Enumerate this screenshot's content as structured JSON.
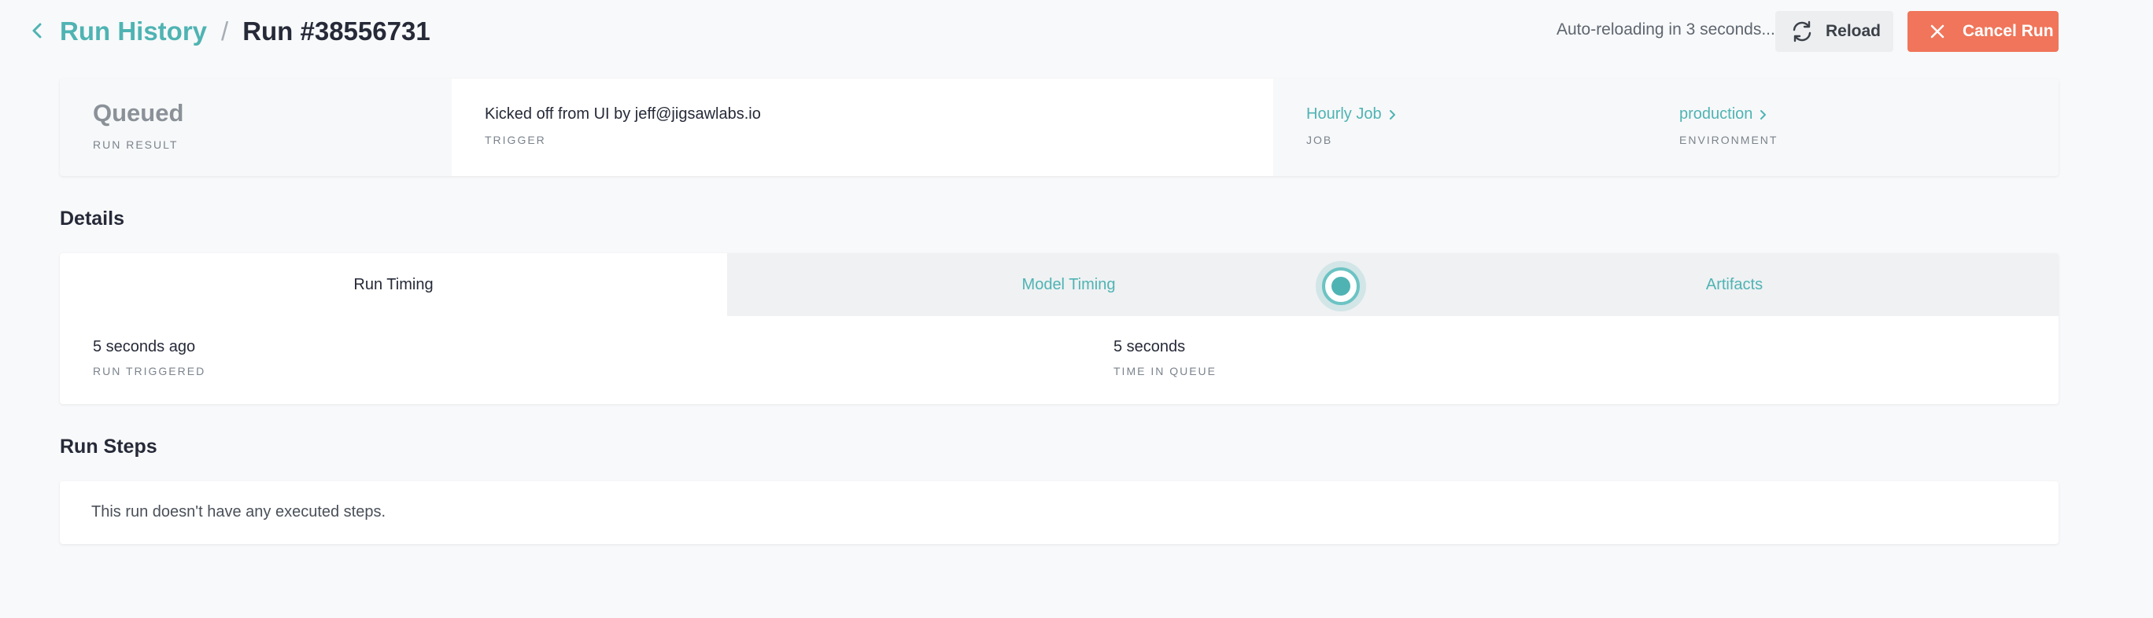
{
  "header": {
    "breadcrumb_parent": "Run History",
    "breadcrumb_separator": "/",
    "run_title": "Run #38556731",
    "auto_reload_text": "Auto-reloading in 3 seconds...",
    "reload_label": "Reload",
    "cancel_label": "Cancel Run"
  },
  "summary": {
    "result_value": "Queued",
    "result_label": "RUN RESULT",
    "trigger_value": "Kicked off from UI by jeff@jigsawlabs.io",
    "trigger_label": "TRIGGER",
    "job_value": "Hourly Job",
    "job_label": "JOB",
    "environment_value": "production",
    "environment_label": "ENVIRONMENT"
  },
  "details": {
    "title": "Details",
    "tabs": [
      {
        "label": "Run Timing",
        "active": true
      },
      {
        "label": "Model Timing",
        "active": false
      },
      {
        "label": "Artifacts",
        "active": false
      }
    ],
    "run_triggered_value": "5 seconds ago",
    "run_triggered_label": "RUN TRIGGERED",
    "time_in_queue_value": "5 seconds",
    "time_in_queue_label": "TIME IN QUEUE"
  },
  "run_steps": {
    "title": "Run Steps",
    "empty_message": "This run doesn't have any executed steps."
  },
  "icons": {
    "back": "chevron-left-icon",
    "reload": "refresh-icon",
    "cancel": "close-icon",
    "link_chevron": "chevron-right-icon"
  },
  "colors": {
    "accent": "#4fb3b3",
    "cancel_button": "#f0755a",
    "background": "#f8f9fa"
  }
}
